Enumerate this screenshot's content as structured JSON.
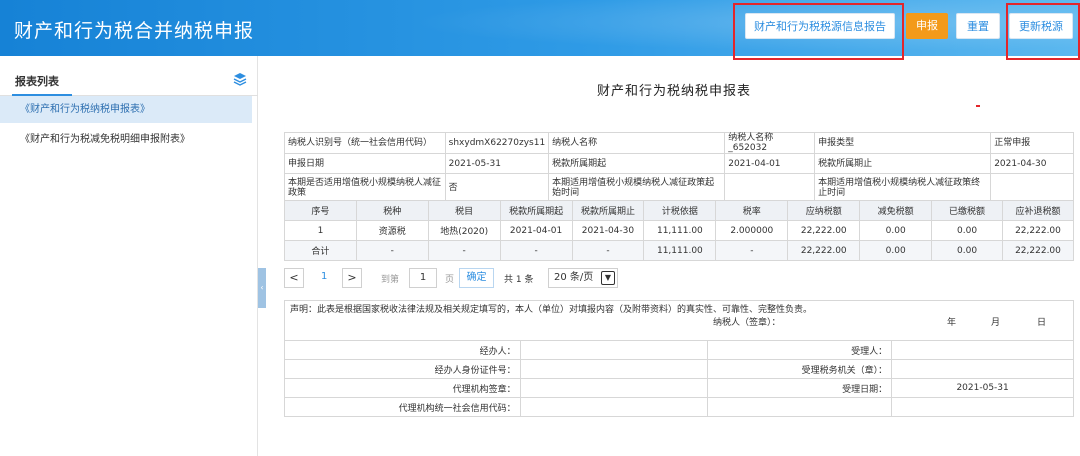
{
  "header": {
    "title": "财产和行为税合并纳税申报",
    "buttons": {
      "report": "财产和行为税税源信息报告",
      "submit": "申报",
      "reset": "重置",
      "update": "更新税源"
    },
    "colors": {
      "primary": "#1682d6",
      "submit": "#f39a1a",
      "highlight": "#e3262b"
    }
  },
  "sidebar": {
    "title": "报表列表",
    "items": [
      {
        "label": "《财产和行为税纳税申报表》"
      },
      {
        "label": "《财产和行为税减免税明细申报附表》"
      }
    ]
  },
  "form": {
    "title": "财产和行为税纳税申报表",
    "info": {
      "taxpayer_id_label": "纳税人识别号（统一社会信用代码）",
      "taxpayer_id": "shxydmX62270zys11",
      "taxpayer_name_label": "纳税人名称",
      "taxpayer_name": "纳税人名称_652032",
      "declare_type_label": "申报类型",
      "declare_type": "正常申报",
      "declare_date_label": "申报日期",
      "declare_date": "2021-05-31",
      "period_start_label": "税款所属期起",
      "period_start": "2021-04-01",
      "period_end_label": "税款所属期止",
      "period_end": "2021-04-30",
      "small_scale_label": "本期是否适用增值税小规模纳税人减征政策",
      "small_scale_value": "否",
      "policy_start_label": "本期适用增值税小规模纳税人减征政策起始时间",
      "policy_start": "",
      "policy_end_label": "本期适用增值税小规模纳税人减征政策终止时间",
      "policy_end": ""
    },
    "table": {
      "headers": [
        "序号",
        "税种",
        "税目",
        "税款所属期起",
        "税款所属期止",
        "计税依据",
        "税率",
        "应纳税额",
        "减免税额",
        "已缴税额",
        "应补退税额"
      ],
      "rows": [
        [
          "1",
          "资源税",
          "地热(2020)",
          "2021-04-01",
          "2021-04-30",
          "11,111.00",
          "2.000000",
          "22,222.00",
          "0.00",
          "0.00",
          "22,222.00"
        ],
        [
          "合计",
          "-",
          "-",
          "-",
          "-",
          "11,111.00",
          "-",
          "22,222.00",
          "0.00",
          "0.00",
          "22,222.00"
        ]
      ]
    },
    "pager": {
      "prev": "<",
      "current": "1",
      "next": ">",
      "goto": "到第",
      "page_input": "1",
      "page_unit": "页",
      "confirm": "确定",
      "total": "共 1 条",
      "page_size": "20 条/页"
    },
    "declaration": {
      "statement": "声明：此表是根据国家税收法律法规及相关规定填写的，本人（单位）对填报内容（及附带资料）的真实性、可靠性、完整性负责。",
      "signer": "纳税人（签章）：",
      "year": "年",
      "month": "月",
      "day": "日",
      "handler": "经办人：",
      "handler_id": "经办人身份证件号：",
      "agency_seal": "代理机构签章：",
      "agency_credit_code": "代理机构统一社会信用代码：",
      "receiver": "受理人：",
      "tax_office": "受理税务机关（章）：",
      "receive_date_label": "受理日期：",
      "receive_date": "2021-05-31"
    }
  }
}
